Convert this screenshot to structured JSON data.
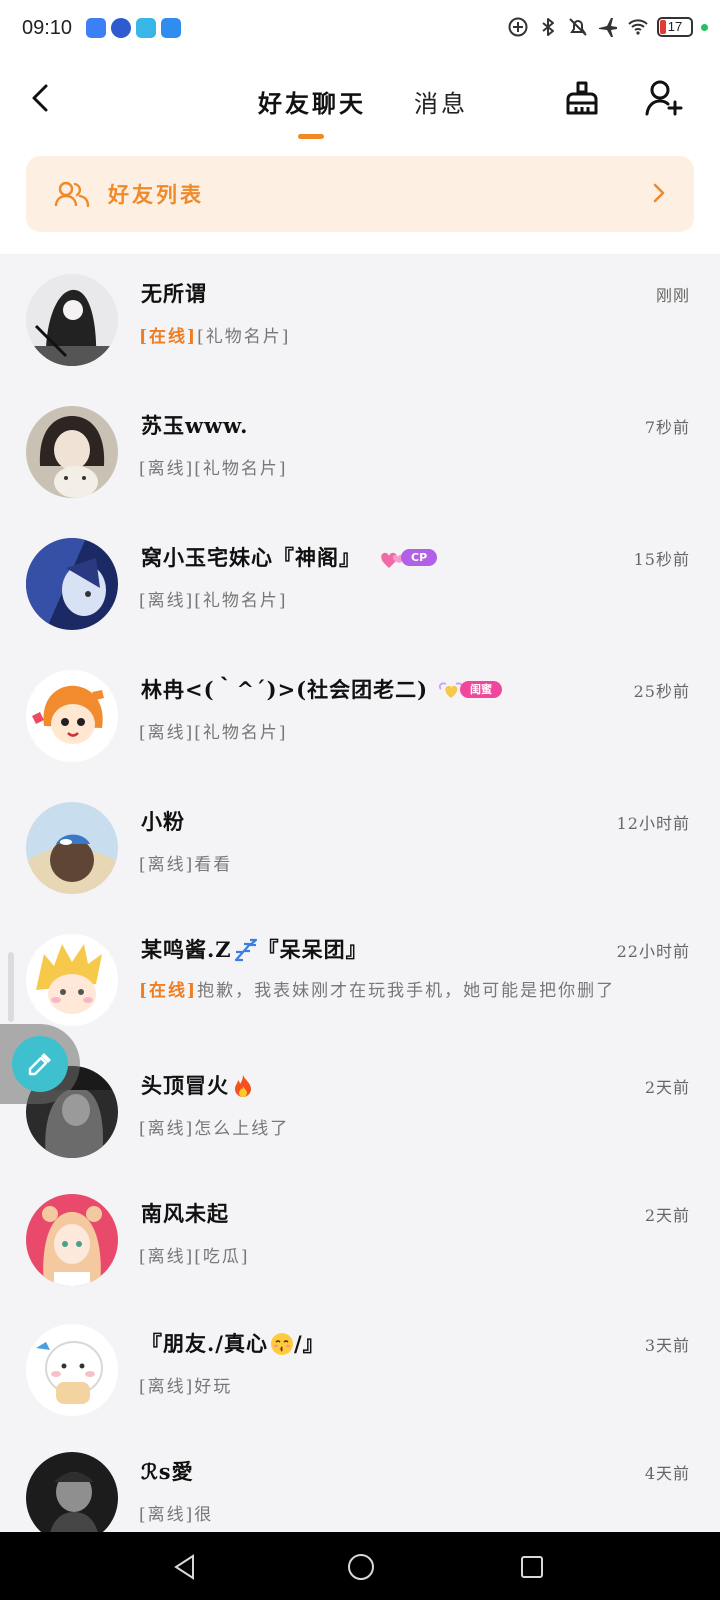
{
  "status_bar": {
    "time": "09:10",
    "battery": "17",
    "app_icons": [
      "blue-app-icon",
      "dark-blue-app-icon",
      "cyan-app-icon",
      "blue-camera-app-icon"
    ],
    "system_icons": [
      "add-circle-icon",
      "bluetooth-icon",
      "bell-off-icon",
      "airplane-icon",
      "wifi-icon",
      "battery-icon"
    ],
    "battery_level_percent": 17,
    "colors": {
      "battery_low": "#e53935",
      "charging_dot": "#21c25e"
    }
  },
  "header": {
    "back_icon": "chevron-left-icon",
    "tabs": [
      {
        "label": "好友聊天",
        "active": true
      },
      {
        "label": "消息",
        "active": false
      }
    ],
    "actions": [
      "broom-icon",
      "add-user-icon"
    ]
  },
  "friends_list": {
    "label": "好友列表",
    "icon": "users-icon",
    "chevron": "chevron-right-icon"
  },
  "chats": [
    {
      "name": "无所谓",
      "time": "刚刚",
      "status": "[在线]",
      "online": true,
      "preview": "[礼物名片]"
    },
    {
      "name": "苏玉www.",
      "time": "7秒前",
      "status": "[离线]",
      "online": false,
      "preview": "[礼物名片]"
    },
    {
      "name": "窝小玉宅妹心『神阁』",
      "time": "15秒前",
      "status": "[离线]",
      "online": false,
      "preview": "[礼物名片]",
      "badge": "CP"
    },
    {
      "name": "林冉<(｀^´)>(社会团老二)",
      "time": "25秒前",
      "status": "[离线]",
      "online": false,
      "preview": "[礼物名片]",
      "badge": "闺蜜"
    },
    {
      "name": "小粉",
      "time": "12小时前",
      "status": "[离线]",
      "online": false,
      "preview": "看看"
    },
    {
      "name": "某鸣酱.Z",
      "name_suffix": "『呆呆团』",
      "time": "22小时前",
      "status": "[在线]",
      "online": true,
      "preview": "抱歉，我表妹刚才在玩我手机，她可能是把你删了"
    },
    {
      "name": "头顶冒火",
      "time": "2天前",
      "status": "[离线]",
      "online": false,
      "preview": "怎么上线了"
    },
    {
      "name": "南风未起",
      "time": "2天前",
      "status": "[离线]",
      "online": false,
      "preview": "[吃瓜]"
    },
    {
      "name": "『朋友./真心",
      "name_suffix": "/』",
      "time": "3天前",
      "status": "[离线]",
      "online": false,
      "preview": "好玩"
    },
    {
      "name": "ℛs愛",
      "time": "4天前",
      "status": "[离线]",
      "online": false,
      "preview": "很"
    }
  ],
  "colors": {
    "accent": "#f28a24",
    "online_text": "#ef7d22",
    "banner_bg": "#fdf0e3",
    "list_bg": "#f4f4f6"
  },
  "floating_tool": "eyedropper-icon",
  "nav_bar": [
    "nav-back-icon",
    "nav-home-icon",
    "nav-recents-icon"
  ]
}
